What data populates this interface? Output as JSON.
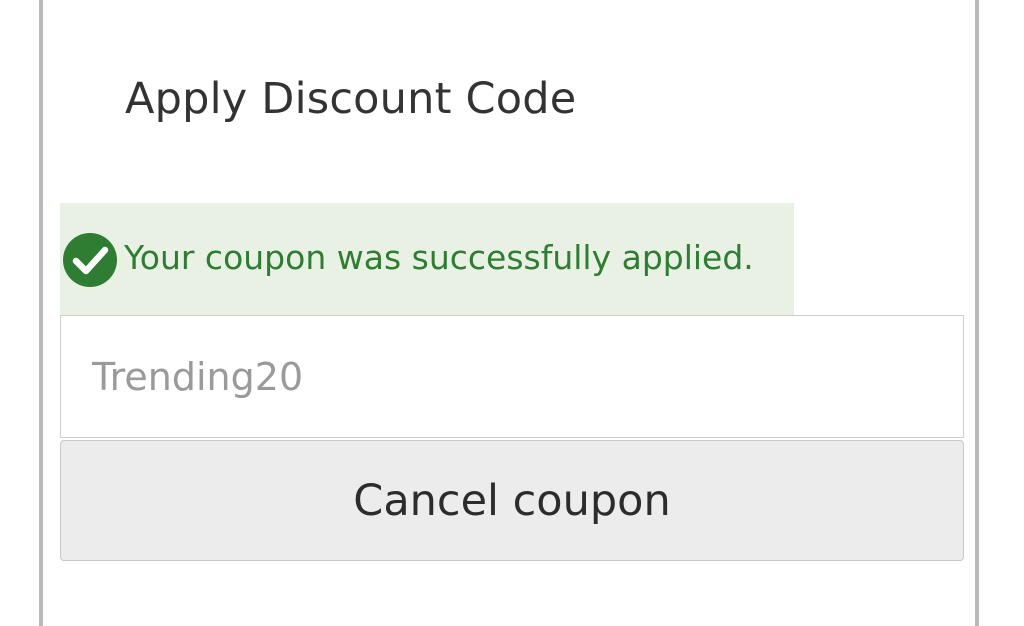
{
  "discount": {
    "title": "Apply Discount Code",
    "message": {
      "text": "Your coupon was successfully applied.",
      "icon": "check-circle-icon",
      "text_color": "#2e7d32",
      "background_color": "#e8f1e4"
    },
    "coupon_input": {
      "value": "Trending20",
      "placeholder": ""
    },
    "cancel_button_label": "Cancel coupon"
  }
}
